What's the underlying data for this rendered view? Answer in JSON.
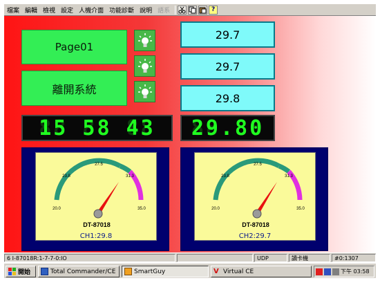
{
  "menu": {
    "items": [
      "檔案",
      "編輯",
      "檢視",
      "設定",
      "人機介面",
      "功能診斷",
      "說明",
      "語系"
    ],
    "disabled_index": 7,
    "tool_buttons": [
      "cut-icon",
      "copy-icon",
      "paste-icon",
      "help-icon"
    ],
    "help_glyph": "?"
  },
  "buttons": {
    "page01": "Page01",
    "exit": "離開系統"
  },
  "displays": [
    "29.7",
    "29.7",
    "29.8"
  ],
  "clock": {
    "value": "15 58 43",
    "ghost": "88 88 88"
  },
  "temp_readout": {
    "value": "29.80",
    "ghost": "88.88"
  },
  "gauges": [
    {
      "model": "DT-87018",
      "channel_label": "CH1:29.8",
      "value": 29.8,
      "min": 20.0,
      "max": 35.0,
      "ticks": [
        "20.0",
        "23.8",
        "27.5",
        "31.3",
        "35.0"
      ]
    },
    {
      "model": "DT-87018",
      "channel_label": "CH2:29.7",
      "value": 29.7,
      "min": 20.0,
      "max": 35.0,
      "ticks": [
        "20.0",
        "23.8",
        "27.5",
        "31.3",
        "35.0"
      ]
    }
  ],
  "status": {
    "left": "6 I-87018R:1-7-7-0:IO",
    "mode": "UDP",
    "user": "讀卡機",
    "code": "#0:1307"
  },
  "taskbar": {
    "start": "開始",
    "tasks": [
      "Total Commander/CE",
      "SmartGuy",
      "Virtual CE"
    ],
    "clock": "下午 03:58"
  },
  "colors": {
    "led_on": "#20ff20",
    "gauge_frame": "#00006e",
    "needle": "#e81010",
    "arc_green": "#2a9a7a",
    "arc_magenta": "#e030e0"
  }
}
